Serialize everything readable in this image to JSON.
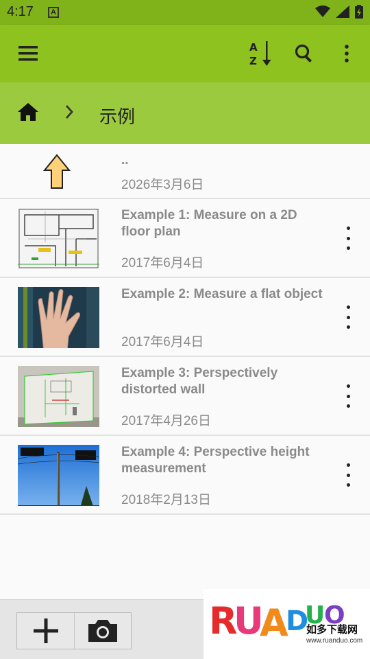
{
  "status_bar": {
    "time": "4:17",
    "icons": [
      "keyboard-a-icon",
      "wifi-icon",
      "signal-icon",
      "battery-icon"
    ]
  },
  "toolbar": {
    "icons": [
      "menu-icon",
      "sort-az-icon",
      "search-icon",
      "more-vert-icon"
    ],
    "color": "#8dc21f"
  },
  "breadcrumb": {
    "home_icon": "home-icon",
    "separator_icon": "chevron-right-icon",
    "current_folder": "示例",
    "color": "#9bca3e"
  },
  "list": {
    "parent": {
      "title": "..",
      "date": "2026年3月6日",
      "icon": "up-arrow-icon"
    },
    "items": [
      {
        "title": "Example 1: Measure on a 2D floor plan",
        "date": "2017年6月4日",
        "thumb": "floor-plan-thumbnail"
      },
      {
        "title": "Example 2: Measure a flat object",
        "date": "2017年6月4日",
        "thumb": "hand-thumbnail"
      },
      {
        "title": "Example 3: Perspectively distorted wall",
        "date": "2017年4月26日",
        "thumb": "wall-thumbnail"
      },
      {
        "title": "Example 4: Perspective height measurement",
        "date": "2018年2月13日",
        "thumb": "pole-thumbnail"
      }
    ]
  },
  "bottom_bar": {
    "buttons": [
      "add-icon",
      "camera-icon"
    ]
  },
  "watermark": {
    "logo_text": "RUANDUO",
    "tagline": "如多下载网",
    "url": "www.ruanduo.com"
  }
}
